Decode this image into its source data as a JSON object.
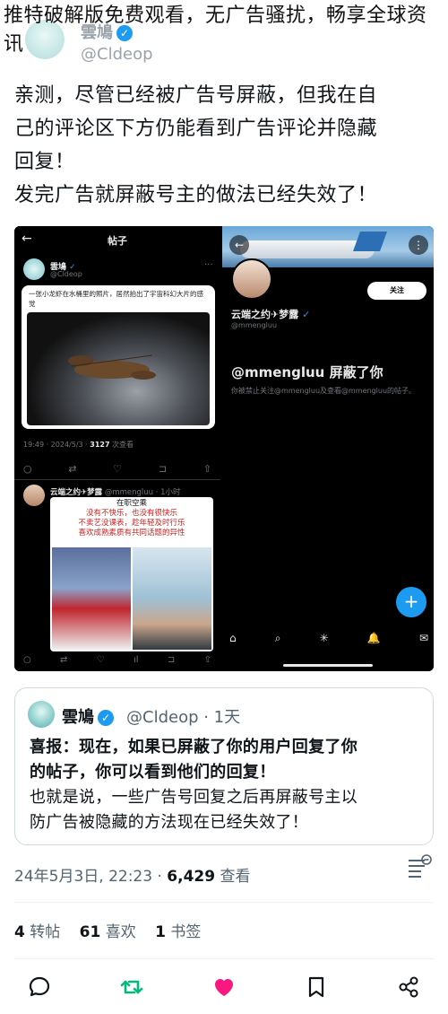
{
  "overlay": {
    "title": "推特破解版免费观看，无广告骚扰，畅享全球资讯"
  },
  "header": {
    "name": "雲鳩",
    "handle": "@Cldeop"
  },
  "post": {
    "text_lines": [
      "亲测，尽管已经被广告号屏蔽，但我在自",
      "己的评论区下方仍能看到广告评论并隐藏",
      "回复！",
      "发完广告就屏蔽号主的做法已经失效了！"
    ]
  },
  "screenshot_left": {
    "back_icon": "←",
    "title": "帖子",
    "author_name": "雲鳩",
    "author_handle": "@Cldeop",
    "more_icon": "···",
    "card_text": "一张小龙虾在水桶里的照片，居然拍出了宇宙科幻大片的感觉",
    "meta_time": "19:49 · 2024/5/3 · ",
    "meta_views": "3127",
    "meta_views_label": " 次查看",
    "actions": [
      "○",
      "⇄",
      "♡",
      "⊐",
      "⇧"
    ],
    "reply_name": "云端之约✈梦露",
    "reply_handle": "@mmengluu · 1小时",
    "reply_card_lines": [
      "在职空乘",
      "没有不快乐，也没有很快乐",
      "不卖艺没课表，趁年轻及时行乐",
      "喜欢成熟素质有共同话题的异性"
    ],
    "reply_actions": [
      "○",
      "⇄",
      "♡",
      "ıl",
      "⊐",
      "⇧"
    ]
  },
  "screenshot_right": {
    "back_icon": "←",
    "more_icon": "⋮",
    "follow_label": "关注",
    "name": "云端之约✈梦露",
    "handle": "@mmengluu",
    "blocked_title": "@mmengluu 屏蔽了你",
    "blocked_desc": "你被禁止关注@mmengluu及查看@mmengluu的帖子。",
    "fab_label": "+",
    "nav": [
      "⌂",
      "⌕",
      "✳",
      "🔔",
      "✉"
    ]
  },
  "quote": {
    "name": "雲鳩",
    "handle": "@Cldeop · 1天",
    "lines": [
      {
        "text": "喜报：现在，如果已屏蔽了你的用户回复了你",
        "bold": true
      },
      {
        "text": "的帖子，你可以看到他们的回复！",
        "bold": true
      },
      {
        "text": "也就是说，一些广告号回复之后再屏蔽号主以",
        "bold": false
      },
      {
        "text": "防广告被隐藏的方法现在已经失效了！",
        "bold": false
      }
    ]
  },
  "timestamp": {
    "time": "24年5月3日, 22:23 · ",
    "views": "6,429",
    "views_label": " 查看"
  },
  "counts": {
    "retweets": "4",
    "retweets_label": "转帖",
    "likes": "61",
    "likes_label": "喜欢",
    "bookmarks": "1",
    "bookmarks_label": "书签"
  },
  "colors": {
    "accent": "#1d9bf0",
    "retweet_green": "#00ba7c",
    "like_pink": "#f91880"
  },
  "icons": [
    "reply-icon",
    "retweet-icon",
    "like-icon",
    "bookmark-icon",
    "share-icon",
    "stats-icon",
    "verified-icon"
  ]
}
